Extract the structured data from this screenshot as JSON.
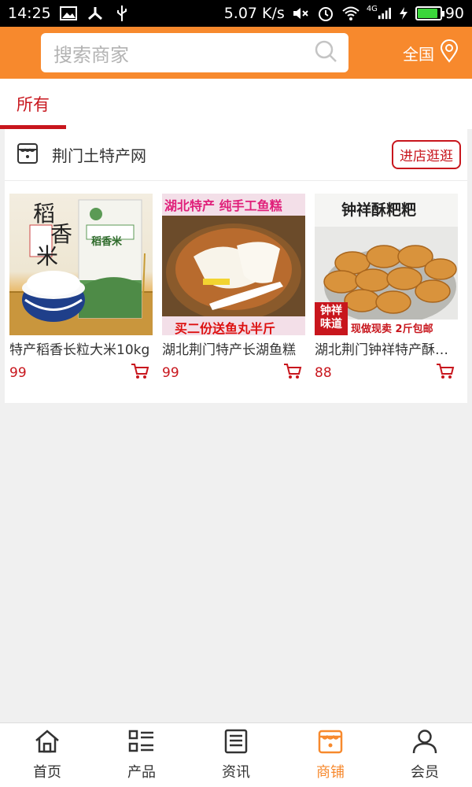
{
  "status_bar": {
    "time": "14:25",
    "speed": "5.07 K/s",
    "network": "4G",
    "battery": "90",
    "battery_level": 0.9
  },
  "header": {
    "search_placeholder": "搜索商家",
    "region_label": "全国",
    "color": "#f7892d"
  },
  "tabs": [
    {
      "label": "所有",
      "active": true
    }
  ],
  "store": {
    "name": "荆门土特产网",
    "visit_label": "进店逛逛"
  },
  "products": [
    {
      "title": "特产稻香长粒大米10kg",
      "price": "99",
      "image_text": [
        "稻",
        "香",
        "米"
      ],
      "bag_label": "稻香米"
    },
    {
      "title": "湖北荆门特产长湖鱼糕",
      "price": "99",
      "image_top": "湖北特产 纯手工鱼糕",
      "image_bottom": "买二份送鱼丸半斤"
    },
    {
      "title": "湖北荆门钟祥特产酥粑粑",
      "price": "88",
      "image_top": "钟祥酥粑粑",
      "image_badge": "钟祥味道",
      "image_bottom": "现做现卖 2斤包邮"
    }
  ],
  "bottom_nav": [
    {
      "label": "首页",
      "icon": "home-icon",
      "active": false
    },
    {
      "label": "产品",
      "icon": "list-icon",
      "active": false
    },
    {
      "label": "资讯",
      "icon": "news-icon",
      "active": false
    },
    {
      "label": "商铺",
      "icon": "shop-icon",
      "active": true
    },
    {
      "label": "会员",
      "icon": "user-icon",
      "active": false
    }
  ],
  "colors": {
    "accent": "#f7892d",
    "red": "#c8161d"
  }
}
